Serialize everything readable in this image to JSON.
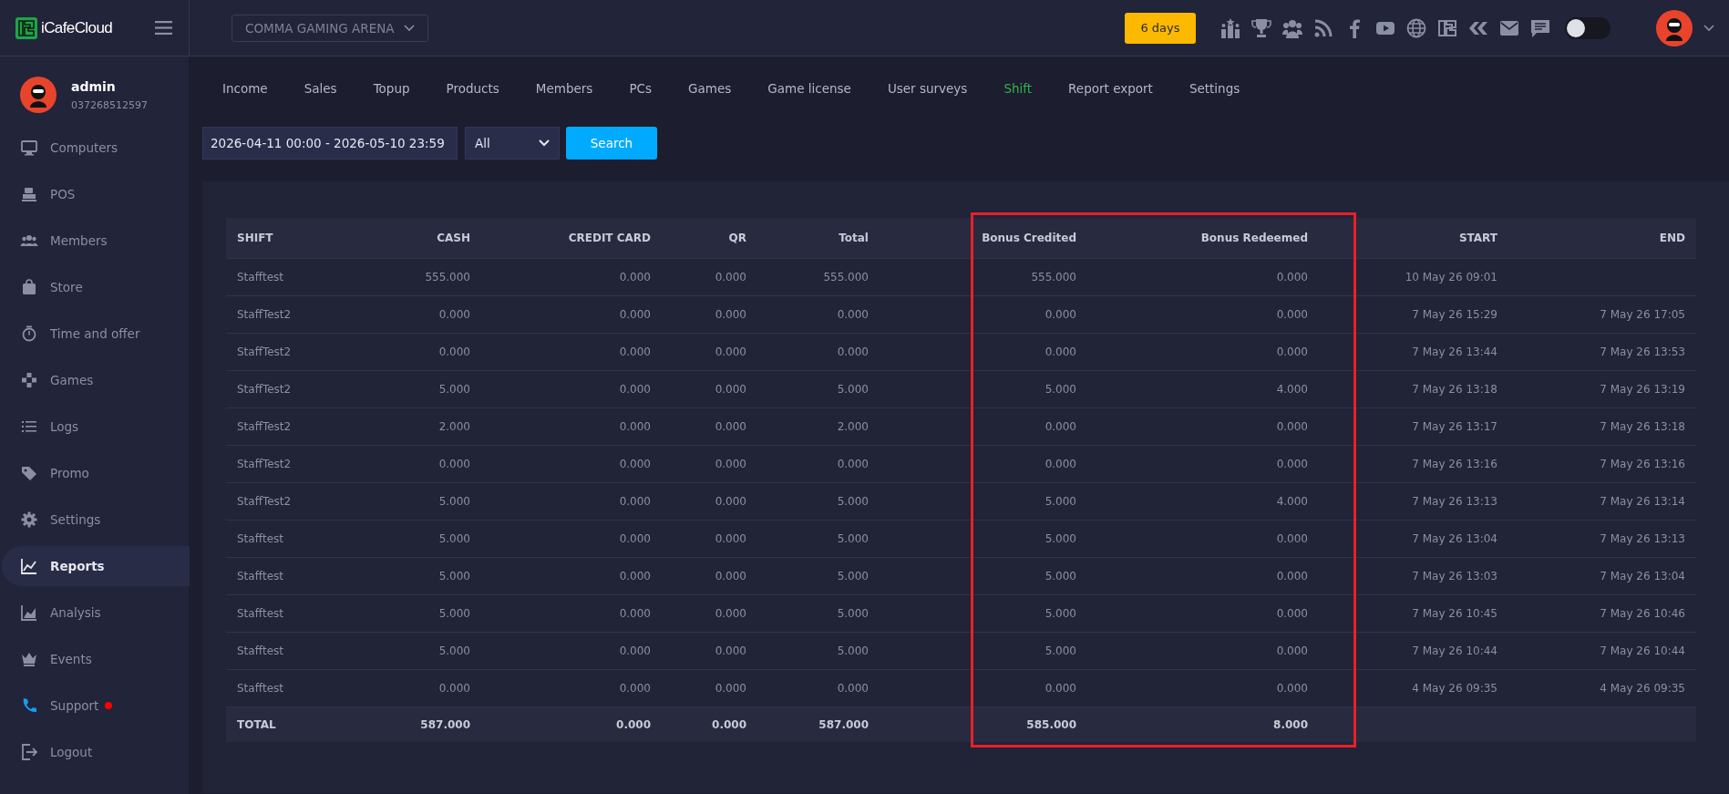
{
  "topbar": {
    "brand": "iCafeCloud",
    "venue": "COMMA GAMING ARENA",
    "license_badge": "6 days",
    "theme_toggle": {
      "on": false
    }
  },
  "profile": {
    "name": "admin",
    "phone": "037268512597"
  },
  "sidebar": {
    "items": [
      {
        "label": "Computers",
        "selected": false,
        "notify": false
      },
      {
        "label": "POS",
        "selected": false,
        "notify": false
      },
      {
        "label": "Members",
        "selected": false,
        "notify": false
      },
      {
        "label": "Store",
        "selected": false,
        "notify": false
      },
      {
        "label": "Time and offer",
        "selected": false,
        "notify": false
      },
      {
        "label": "Games",
        "selected": false,
        "notify": false
      },
      {
        "label": "Logs",
        "selected": false,
        "notify": false
      },
      {
        "label": "Promo",
        "selected": false,
        "notify": false
      },
      {
        "label": "Settings",
        "selected": false,
        "notify": false
      },
      {
        "label": "Reports",
        "selected": true,
        "notify": false
      },
      {
        "label": "Analysis",
        "selected": false,
        "notify": false
      },
      {
        "label": "Events",
        "selected": false,
        "notify": false
      },
      {
        "label": "Support",
        "selected": false,
        "notify": true
      },
      {
        "label": "Logout",
        "selected": false,
        "notify": false
      }
    ]
  },
  "tabs": [
    {
      "label": "Income",
      "selected": false
    },
    {
      "label": "Sales",
      "selected": false
    },
    {
      "label": "Topup",
      "selected": false
    },
    {
      "label": "Products",
      "selected": false
    },
    {
      "label": "Members",
      "selected": false
    },
    {
      "label": "PCs",
      "selected": false
    },
    {
      "label": "Games",
      "selected": false
    },
    {
      "label": "Game license",
      "selected": false
    },
    {
      "label": "User surveys",
      "selected": false
    },
    {
      "label": "Shift",
      "selected": true
    },
    {
      "label": "Report export",
      "selected": false
    },
    {
      "label": "Settings",
      "selected": false
    }
  ],
  "filter": {
    "date_range": "2026-04-11 00:00 - 2026-05-10 23:59",
    "type": "All",
    "search_button": "Search"
  },
  "table": {
    "columns": [
      {
        "label": "SHIFT",
        "highlighted": false
      },
      {
        "label": "CASH",
        "highlighted": false
      },
      {
        "label": "CREDIT CARD",
        "highlighted": false
      },
      {
        "label": "QR",
        "highlighted": false
      },
      {
        "label": "Total",
        "highlighted": false
      },
      {
        "label": "Bonus Credited",
        "highlighted": true
      },
      {
        "label": "Bonus Redeemed",
        "highlighted": true
      },
      {
        "label": "START",
        "highlighted": false
      },
      {
        "label": "END",
        "highlighted": false
      }
    ],
    "rows": [
      {
        "shift": "Stafftest",
        "cash": "555.000",
        "credit_card": "0.000",
        "qr": "0.000",
        "total": "555.000",
        "bonus_credited": "555.000",
        "bonus_redeemed": "0.000",
        "start": "10 May 26 09:01"
      },
      {
        "shift": "StaffTest2",
        "cash": "0.000",
        "credit_card": "0.000",
        "qr": "0.000",
        "total": "0.000",
        "bonus_credited": "0.000",
        "bonus_redeemed": "0.000",
        "start": "7 May 26 15:29",
        "end": "7 May 26 17:05"
      },
      {
        "shift": "StaffTest2",
        "cash": "0.000",
        "credit_card": "0.000",
        "qr": "0.000",
        "total": "0.000",
        "bonus_credited": "0.000",
        "bonus_redeemed": "0.000",
        "start": "7 May 26 13:44",
        "end": "7 May 26 13:53"
      },
      {
        "shift": "StaffTest2",
        "cash": "5.000",
        "credit_card": "0.000",
        "qr": "0.000",
        "total": "5.000",
        "bonus_credited": "5.000",
        "bonus_redeemed": "4.000",
        "start": "7 May 26 13:18",
        "end": "7 May 26 13:19"
      },
      {
        "shift": "StaffTest2",
        "cash": "2.000",
        "credit_card": "0.000",
        "qr": "0.000",
        "total": "2.000",
        "bonus_credited": "0.000",
        "bonus_redeemed": "0.000",
        "start": "7 May 26 13:17",
        "end": "7 May 26 13:18"
      },
      {
        "shift": "StaffTest2",
        "cash": "0.000",
        "credit_card": "0.000",
        "qr": "0.000",
        "total": "0.000",
        "bonus_credited": "0.000",
        "bonus_redeemed": "0.000",
        "start": "7 May 26 13:16",
        "end": "7 May 26 13:16"
      },
      {
        "shift": "StaffTest2",
        "cash": "5.000",
        "credit_card": "0.000",
        "qr": "0.000",
        "total": "5.000",
        "bonus_credited": "5.000",
        "bonus_redeemed": "4.000",
        "start": "7 May 26 13:13",
        "end": "7 May 26 13:14"
      },
      {
        "shift": "Stafftest",
        "cash": "5.000",
        "credit_card": "0.000",
        "qr": "0.000",
        "total": "5.000",
        "bonus_credited": "5.000",
        "bonus_redeemed": "0.000",
        "start": "7 May 26 13:04",
        "end": "7 May 26 13:13"
      },
      {
        "shift": "Stafftest",
        "cash": "5.000",
        "credit_card": "0.000",
        "qr": "0.000",
        "total": "5.000",
        "bonus_credited": "5.000",
        "bonus_redeemed": "0.000",
        "start": "7 May 26 13:03",
        "end": "7 May 26 13:04"
      },
      {
        "shift": "Stafftest",
        "cash": "5.000",
        "credit_card": "0.000",
        "qr": "0.000",
        "total": "5.000",
        "bonus_credited": "5.000",
        "bonus_redeemed": "0.000",
        "start": "7 May 26 10:45",
        "end": "7 May 26 10:46"
      },
      {
        "shift": "Stafftest",
        "cash": "5.000",
        "credit_card": "0.000",
        "qr": "0.000",
        "total": "5.000",
        "bonus_credited": "5.000",
        "bonus_redeemed": "0.000",
        "start": "7 May 26 10:44",
        "end": "7 May 26 10:44"
      },
      {
        "shift": "Stafftest",
        "cash": "0.000",
        "credit_card": "0.000",
        "qr": "0.000",
        "total": "0.000",
        "bonus_credited": "0.000",
        "bonus_redeemed": "0.000",
        "start": "4 May 26 09:35",
        "end": "4 May 26 09:35"
      }
    ],
    "total_row": {
      "shift": "TOTAL",
      "cash": "587.000",
      "credit_card": "0.000",
      "qr": "0.000",
      "total": "587.000",
      "bonus_credited": "585.000",
      "bonus_redeemed": "8.000"
    }
  }
}
